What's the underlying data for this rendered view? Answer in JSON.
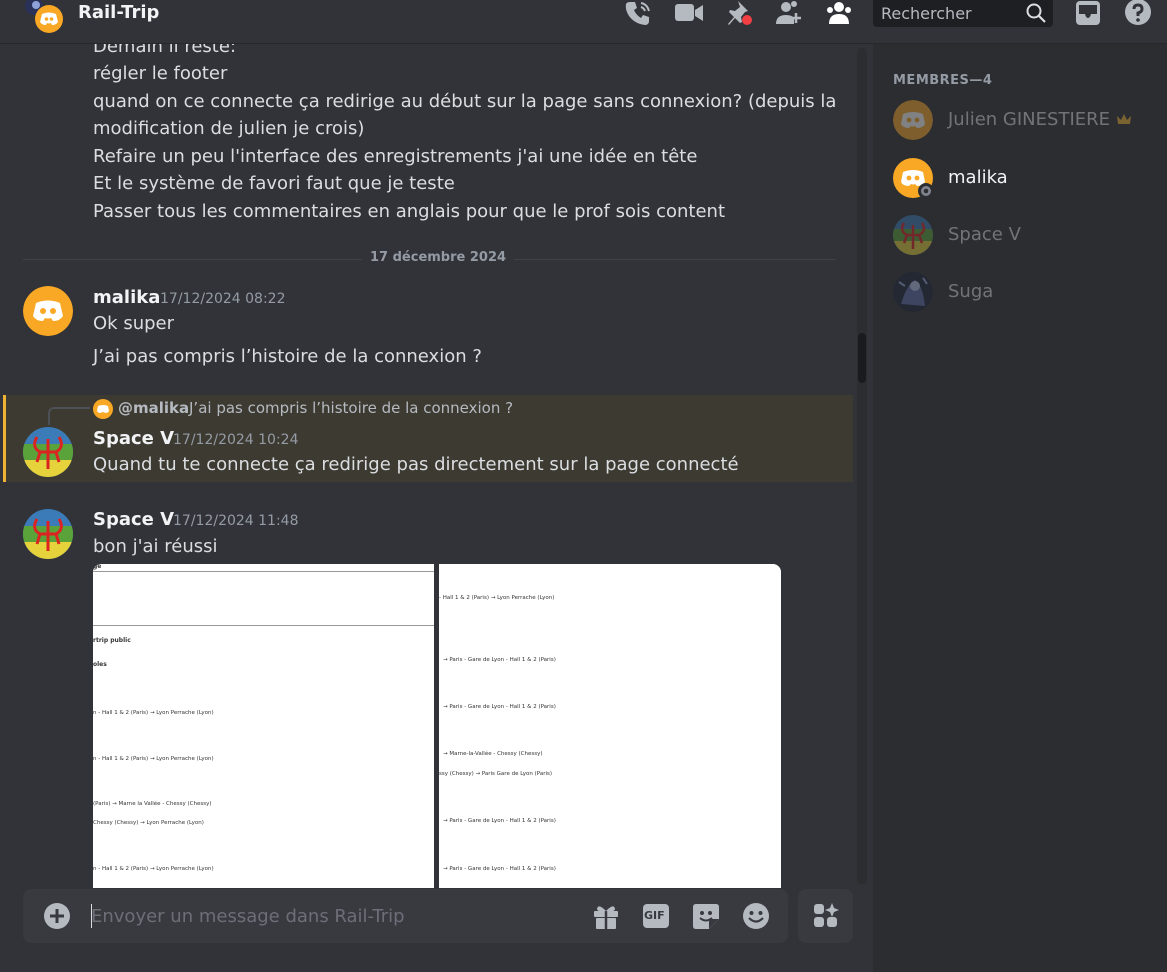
{
  "header": {
    "title": "Rail-Trip",
    "search_placeholder": "Rechercher"
  },
  "messages": {
    "continuation_lines": [
      "Demain il reste:",
      "régler le footer",
      "quand on ce connecte ça redirige au début sur la page sans connexion? (depuis la",
      "modification de julien je crois)",
      "Refaire un peu l'interface des enregistrements j'ai une idée en tête",
      "Et le système de favori faut que je teste",
      "Passer tous les commentaires en anglais pour que le prof sois content"
    ],
    "date_divider": "17 décembre 2024",
    "msg1": {
      "author": "malika",
      "timestamp": "17/12/2024 08:22",
      "lines": [
        "Ok super",
        "J’ai pas compris l’histoire de la connexion ?"
      ]
    },
    "msg2": {
      "reply_author": "@malika",
      "reply_text": "J’ai pas compris l’histoire de la connexion ?",
      "author": "Space V",
      "timestamp": "17/12/2024 10:24",
      "text": "Quand tu te connecte ça redirige pas directement sur la page connecté"
    },
    "msg3": {
      "author": "Space V",
      "timestamp": "17/12/2024 11:48",
      "text": "bon j'ai réussi"
    }
  },
  "attachments": {
    "left": {
      "heading": "ge",
      "lines": [
        "rtrip public",
        "oles",
        "n - Hall 1 & 2 (Paris) → Lyon Perrache (Lyon)",
        "n - Hall 1 & 2 (Paris) → Lyon Perrache (Lyon)",
        "(Paris) → Marne la Vallée - Chessy (Chessy)",
        "Chessy (Chessy) → Lyon Perrache (Lyon)",
        "n - Hall 1 & 2 (Paris) → Lyon Perrache (Lyon)"
      ]
    },
    "right": {
      "lines": [
        "- Hall 1 & 2 (Paris) → Lyon Perrache (Lyon)",
        "→ Paris - Gare de Lyon - Hall 1 & 2 (Paris)",
        "→ Paris - Gare de Lyon - Hall 1 & 2 (Paris)",
        "→ Marne-la-Vallée - Chessy (Chessy)",
        "ssy (Chessy) → Paris Gare de Lyon (Paris)",
        "→ Paris - Gare de Lyon - Hall 1 & 2 (Paris)",
        "→ Paris - Gare de Lyon - Hall 1 & 2 (Paris)"
      ]
    }
  },
  "composer": {
    "placeholder": "Envoyer un message dans Rail-Trip",
    "gif_label": "GIF"
  },
  "members": {
    "header": "MEMBRES—4",
    "list": [
      {
        "name": "Julien GINESTIERE",
        "status": "offline",
        "owner": true
      },
      {
        "name": "malika",
        "status": "online"
      },
      {
        "name": "Space V",
        "status": "offline"
      },
      {
        "name": "Suga",
        "status": "offline"
      }
    ]
  },
  "colors": {
    "accent_orange": "#f0b232",
    "discord_orange": "#f9a825",
    "mention_bg": "#3d3a32",
    "unread_red": "#f23f43"
  }
}
